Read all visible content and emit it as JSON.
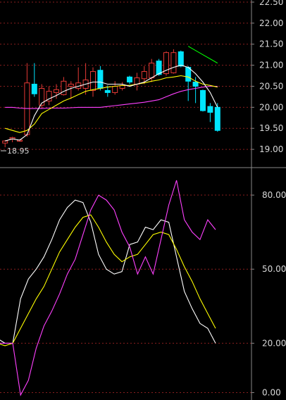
{
  "chart_data": [
    {
      "id": "price",
      "type": "candlestick",
      "ylim": [
        18.6,
        22.55
      ],
      "yticks": [
        "22.50",
        "22.00",
        "21.50",
        "21.00",
        "20.50",
        "20.00",
        "19.50",
        "19.00"
      ],
      "annotation": "18.95",
      "colors": {
        "up": "#e53935",
        "down": "#00e5ff",
        "ma_short": "#ffffff",
        "ma_mid": "#ffff00",
        "ma_long": "#ff40ff",
        "ma_extra": "#00ff00"
      },
      "candles": [
        {
          "o": 19.15,
          "h": 19.22,
          "l": 19.05,
          "c": 19.2
        },
        {
          "o": 19.25,
          "h": 19.3,
          "l": 19.17,
          "c": 19.28
        },
        {
          "o": 19.2,
          "h": 19.24,
          "l": 19.18,
          "c": 19.22
        },
        {
          "o": 19.35,
          "h": 21.05,
          "l": 19.3,
          "c": 20.58
        },
        {
          "o": 20.55,
          "h": 21.05,
          "l": 20.25,
          "c": 20.32
        },
        {
          "o": 20.05,
          "h": 20.55,
          "l": 19.98,
          "c": 20.45
        },
        {
          "o": 20.15,
          "h": 20.5,
          "l": 20.05,
          "c": 20.38
        },
        {
          "o": 20.35,
          "h": 20.55,
          "l": 20.2,
          "c": 20.42
        },
        {
          "o": 20.3,
          "h": 20.72,
          "l": 20.28,
          "c": 20.62
        },
        {
          "o": 20.5,
          "h": 20.62,
          "l": 20.2,
          "c": 20.55
        },
        {
          "o": 20.45,
          "h": 20.95,
          "l": 20.4,
          "c": 20.58
        },
        {
          "o": 20.45,
          "h": 21.05,
          "l": 20.3,
          "c": 20.65
        },
        {
          "o": 20.4,
          "h": 20.95,
          "l": 20.25,
          "c": 20.85
        },
        {
          "o": 20.88,
          "h": 20.98,
          "l": 20.4,
          "c": 20.45
        },
        {
          "o": 20.4,
          "h": 20.52,
          "l": 20.25,
          "c": 20.35
        },
        {
          "o": 20.35,
          "h": 20.62,
          "l": 20.3,
          "c": 20.5
        },
        {
          "o": 20.45,
          "h": 20.6,
          "l": 20.4,
          "c": 20.52
        },
        {
          "o": 20.72,
          "h": 20.75,
          "l": 20.55,
          "c": 20.6
        },
        {
          "o": 20.55,
          "h": 20.82,
          "l": 20.4,
          "c": 20.7
        },
        {
          "o": 20.68,
          "h": 20.98,
          "l": 20.55,
          "c": 20.85
        },
        {
          "o": 20.7,
          "h": 21.15,
          "l": 20.6,
          "c": 21.05
        },
        {
          "o": 21.1,
          "h": 21.15,
          "l": 20.75,
          "c": 20.78
        },
        {
          "o": 20.8,
          "h": 21.33,
          "l": 20.75,
          "c": 21.3
        },
        {
          "o": 20.82,
          "h": 21.38,
          "l": 20.8,
          "c": 21.3
        },
        {
          "o": 21.32,
          "h": 21.35,
          "l": 20.95,
          "c": 20.98
        },
        {
          "o": 20.95,
          "h": 20.98,
          "l": 20.15,
          "c": 20.62
        },
        {
          "o": 20.6,
          "h": 20.72,
          "l": 20.1,
          "c": 20.5
        },
        {
          "o": 20.4,
          "h": 20.42,
          "l": 19.9,
          "c": 19.92
        },
        {
          "o": 20.02,
          "h": 20.1,
          "l": 19.65,
          "c": 19.88
        },
        {
          "o": 20.0,
          "h": 20.1,
          "l": 19.42,
          "c": 19.45
        }
      ],
      "ma_short": [
        19.2,
        19.25,
        19.22,
        19.35,
        19.8,
        20.1,
        20.2,
        20.28,
        20.38,
        20.45,
        20.5,
        20.55,
        20.6,
        20.6,
        20.55,
        20.55,
        20.55,
        20.5,
        20.55,
        20.6,
        20.7,
        20.8,
        20.88,
        20.95,
        21.0,
        20.95,
        20.8,
        20.6,
        20.35,
        20.0
      ],
      "ma_mid": [
        19.5,
        19.45,
        19.4,
        19.45,
        19.6,
        19.85,
        19.95,
        20.05,
        20.15,
        20.22,
        20.3,
        20.38,
        20.42,
        20.45,
        20.48,
        20.5,
        20.52,
        20.52,
        20.55,
        20.58,
        20.62,
        20.65,
        20.7,
        20.72,
        20.75,
        20.72,
        20.62,
        20.55,
        20.52,
        20.48
      ],
      "ma_long": [
        20.0,
        20.0,
        19.98,
        19.97,
        19.97,
        19.97,
        19.98,
        19.98,
        19.98,
        19.99,
        20.0,
        20.0,
        20.0,
        20.0,
        20.02,
        20.04,
        20.06,
        20.08,
        20.1,
        20.12,
        20.15,
        20.18,
        20.25,
        20.32,
        20.38,
        20.42,
        20.45,
        20.48,
        20.5,
        20.5
      ],
      "ma_extra": [
        null,
        null,
        null,
        null,
        null,
        null,
        null,
        null,
        null,
        null,
        null,
        null,
        null,
        null,
        null,
        null,
        null,
        null,
        null,
        null,
        null,
        null,
        null,
        null,
        null,
        21.45,
        21.35,
        21.25,
        21.15,
        21.05
      ]
    },
    {
      "id": "indicator",
      "type": "line",
      "ylim": [
        -3,
        90
      ],
      "yticks": [
        "80.00",
        "50.00",
        "20.00",
        "0.00"
      ],
      "series": [
        {
          "color": "#ffffff",
          "values": [
            22,
            20,
            20,
            38,
            46,
            50,
            55,
            62,
            70,
            75,
            78,
            77,
            69,
            56,
            50,
            48,
            49,
            60,
            61,
            67,
            66,
            70,
            69,
            55,
            41,
            34,
            28,
            26,
            20
          ]
        },
        {
          "color": "#ffff00",
          "values": [
            20,
            19,
            20,
            26,
            32,
            38,
            43,
            50,
            57,
            62,
            67,
            71,
            72,
            67,
            61,
            56,
            53,
            55,
            56,
            60,
            64,
            65,
            64,
            58,
            51,
            45,
            38,
            32,
            26
          ]
        },
        {
          "color": "#ff40ff",
          "values": [
            20,
            20,
            20,
            -1,
            5,
            18,
            27,
            33,
            40,
            48,
            54,
            64,
            74,
            80,
            78,
            74,
            65,
            59,
            48,
            55,
            48,
            62,
            76,
            86,
            70,
            65,
            62,
            70,
            66
          ]
        }
      ]
    }
  ]
}
